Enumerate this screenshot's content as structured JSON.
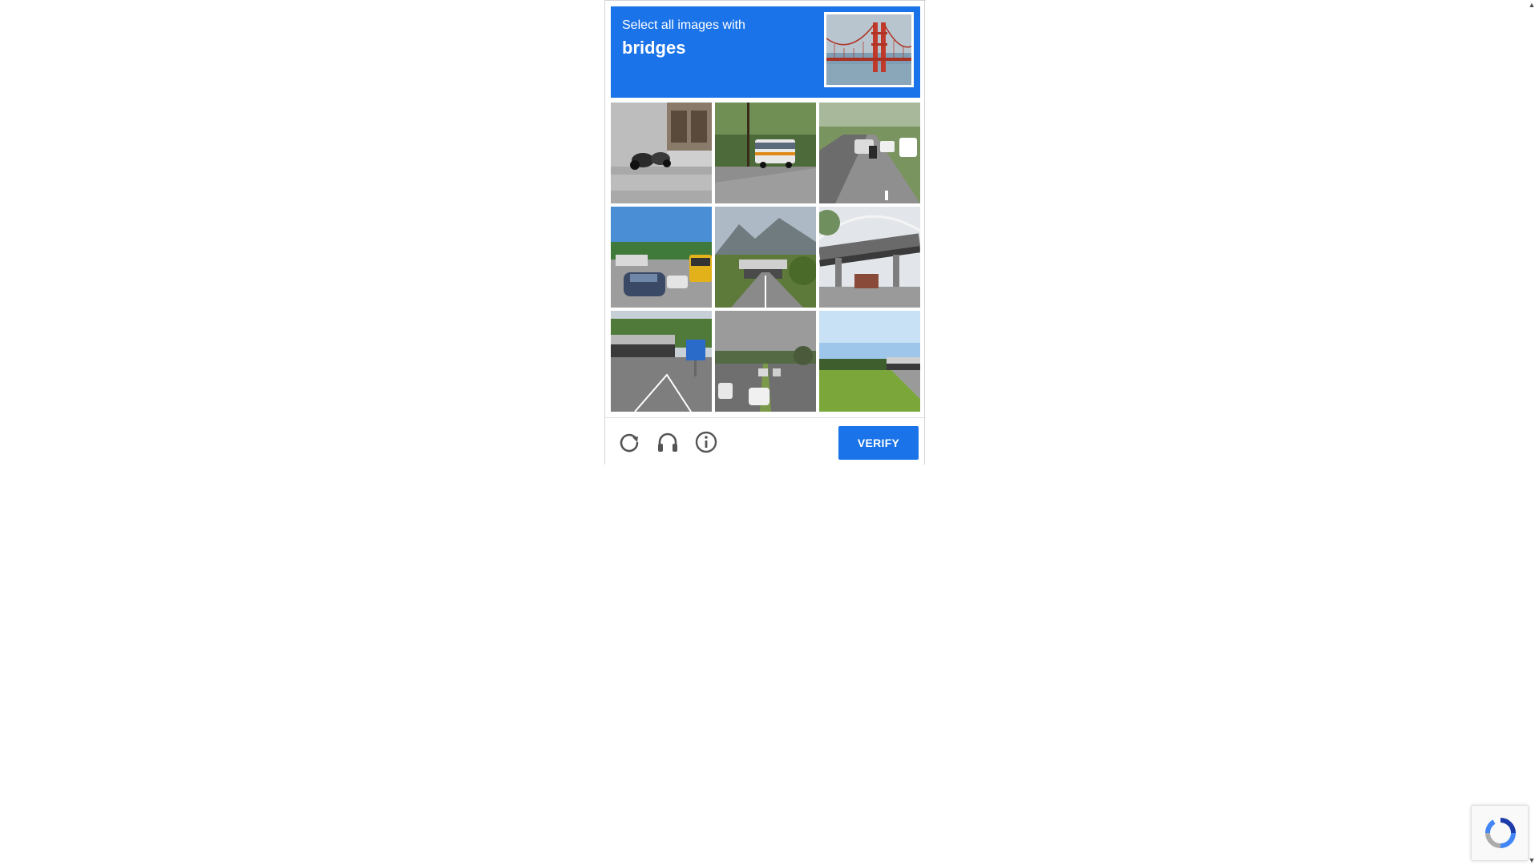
{
  "challenge": {
    "prompt_line": "Select all images with",
    "prompt_target": "bridges",
    "sample_image": "golden-gate-bridge"
  },
  "tiles": [
    {
      "row": 1,
      "col": 1,
      "subject": "motorcycles-parked-by-building"
    },
    {
      "row": 1,
      "col": 2,
      "subject": "bus-on-tree-lined-road"
    },
    {
      "row": 1,
      "col": 3,
      "subject": "cars-and-motorcycle-on-highway"
    },
    {
      "row": 2,
      "col": 1,
      "subject": "parking-lot-with-car-and-school-bus"
    },
    {
      "row": 2,
      "col": 2,
      "subject": "road-under-bridge-with-mountains"
    },
    {
      "row": 2,
      "col": 3,
      "subject": "highway-overpass"
    },
    {
      "row": 3,
      "col": 1,
      "subject": "road-under-overpass-with-sign"
    },
    {
      "row": 3,
      "col": 2,
      "subject": "traffic-on-street"
    },
    {
      "row": 3,
      "col": 3,
      "subject": "overpass-with-grass-embankment"
    }
  ],
  "footer": {
    "reload_icon": "reload-icon",
    "audio_icon": "headphones-icon",
    "info_icon": "info-icon",
    "verify_label": "VERIFY"
  },
  "colors": {
    "accent": "#1a73e8",
    "header_text": "#ffffff",
    "icon_gray": "#555555"
  }
}
